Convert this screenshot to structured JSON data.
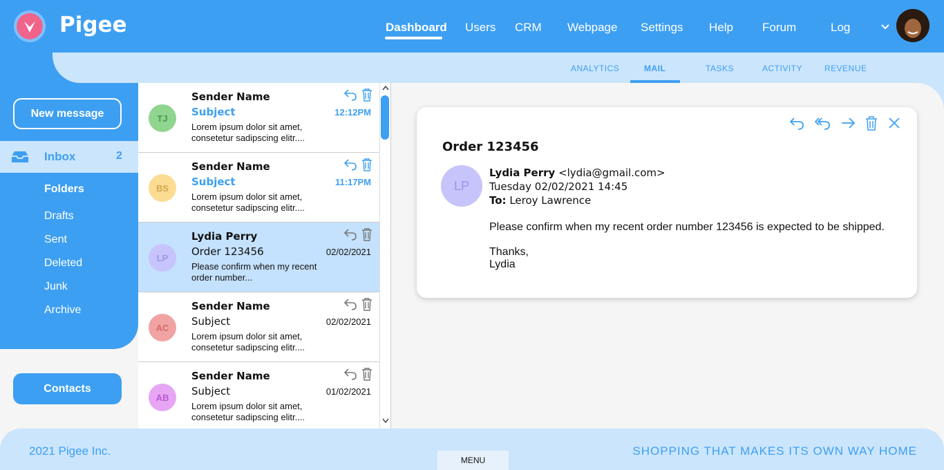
{
  "brand": "Pigee",
  "nav": [
    "Dashboard",
    "Users",
    "CRM",
    "Webpage",
    "Settings",
    "Help",
    "Forum",
    "Log"
  ],
  "subnav": [
    "ANALYTICS",
    "MAIL",
    "TASKS",
    "ACTIVITY",
    "REVENUE"
  ],
  "sidebar": {
    "new_message": "New message",
    "inbox": "Inbox",
    "inbox_count": "2",
    "folders_title": "Folders",
    "folders": [
      "Drafts",
      "Sent",
      "Deleted",
      "Junk",
      "Archive"
    ],
    "contacts": "Contacts"
  },
  "mails": [
    {
      "initials": "TJ",
      "sender": "Sender Name",
      "subject": "Subject",
      "time": "12:12PM",
      "preview": "Lorem ipsum dolor sit amet, consetetur sadipscing elitr....",
      "unread": true,
      "bg": "#8fd48f",
      "fg": "#4a9a4a"
    },
    {
      "initials": "BS",
      "sender": "Sender Name",
      "subject": "Subject",
      "time": "11:17PM",
      "preview": "Lorem ipsum dolor sit amet, consetetur sadipscing elitr....",
      "unread": true,
      "bg": "#fcdb93",
      "fg": "#d4a84a"
    },
    {
      "initials": "LP",
      "sender": "Lydia Perry",
      "subject": "Order 123456",
      "time": "02/02/2021",
      "preview": "Please confirm when my recent order number...",
      "unread": false,
      "bg": "#c7c4fb",
      "fg": "#9a96ee"
    },
    {
      "initials": "AC",
      "sender": "Sender Name",
      "subject": "Subject",
      "time": "02/02/2021",
      "preview": "Lorem ipsum dolor sit amet, consetetur sadipscing elitr....",
      "unread": false,
      "bg": "#f1a3a3",
      "fg": "#d46a6a"
    },
    {
      "initials": "AB",
      "sender": "Sender Name",
      "subject": "Subject",
      "time": "01/02/2021",
      "preview": "Lorem ipsum dolor sit amet, consetetur sadipscing elitr....",
      "unread": false,
      "bg": "#e6a6f4",
      "fg": "#b85ad1"
    }
  ],
  "reading": {
    "title": "Order 123456",
    "initials": "LP",
    "from_name": "Lydia Perry",
    "from_email": "<lydia@gmail.com>",
    "date": "Tuesday 02/02/2021 14:45",
    "to_label": "To:",
    "to_name": "Leroy Lawrence",
    "body": "Please confirm when my recent order number 123456 is expected to be shipped.",
    "sign1": "Thanks,",
    "sign2": "Lydia"
  },
  "footer": {
    "left": "2021 Pigee Inc.",
    "right": "SHOPPING THAT MAKES ITS OWN WAY HOME",
    "menu": "MENU"
  }
}
